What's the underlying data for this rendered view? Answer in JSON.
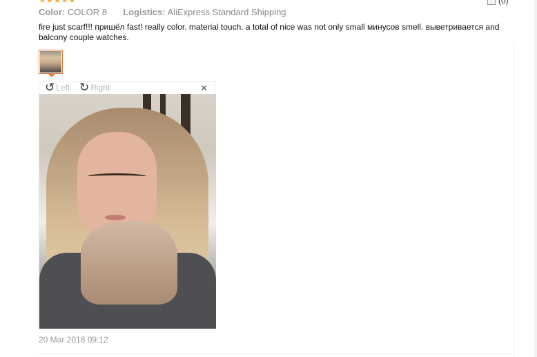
{
  "rating": {
    "stars": "★★★★★"
  },
  "helpful": {
    "count": "(0)"
  },
  "meta": {
    "color_label": "Color:",
    "color_value": "COLOR 8",
    "logistics_label": "Logistics:",
    "logistics_value": "AliExpress Standard Shipping"
  },
  "review": {
    "text": "fire just scarf!!! пришёл fast! really color. material touch. a total of nice was not only small минусов smell. выветривается and balcony couple watches."
  },
  "viewer": {
    "rotate_left_label": "Left",
    "rotate_right_label": "Right",
    "rotate_left_icon": "rotate-left-icon",
    "rotate_right_icon": "rotate-right-icon",
    "close_icon": "close-icon",
    "close_glyph": "✕"
  },
  "date": "20 Mar 2018 09:12",
  "colors": {
    "accent": "#e07a3f",
    "star": "#f5a623"
  }
}
